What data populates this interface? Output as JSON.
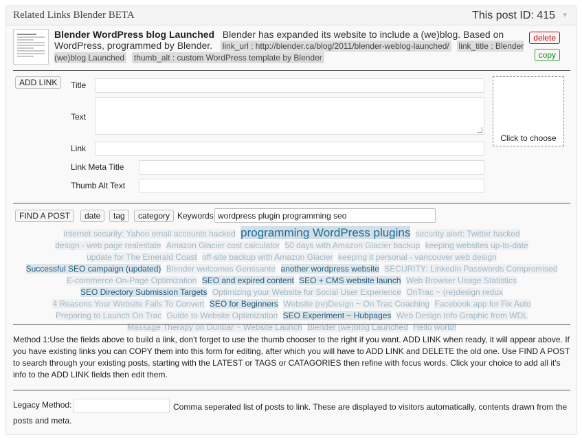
{
  "metabox": {
    "title": "Related Links Blender BETA",
    "post_id": "This post ID: 415",
    "toggle_glyph": "▼"
  },
  "existing_link": {
    "title": "Blender WordPress blog Launched",
    "description": "Blender has expanded its website to include a (we)blog.  Based on WordPress, programmed by Blender.",
    "link_url": "link_url : http://blender.ca/blog/2011/blender-weblog-launched/",
    "link_title": "link_title : Blender (we)blog Launched",
    "thumb_alt": "thumb_alt : custom WordPress template by Blender",
    "delete_label": "delete",
    "copy_label": "copy"
  },
  "form": {
    "add_link_label": "ADD LINK",
    "title_label": "Title",
    "title_value": "",
    "text_label": "Text",
    "text_value": "",
    "link_label": "Link",
    "link_value": "",
    "meta_title_label": "Link Meta Title",
    "meta_title_value": "",
    "thumb_alt_label": "Thumb Alt Text",
    "thumb_alt_value": "",
    "chooser_label": "Click to choose"
  },
  "search": {
    "find_label": "FIND A POST",
    "date_label": "date",
    "tag_label": "tag",
    "category_label": "category",
    "keywords_label": "Keywords",
    "keywords_value": "wordpress plugin programming seo"
  },
  "tags": [
    {
      "text": "internet security: Yahoo email accounts hacked",
      "weight": 1
    },
    {
      "text": "programming WordPress plugins",
      "weight": 4
    },
    {
      "text": "security alert: Twitter hacked",
      "weight": 1
    },
    {
      "text": "design - web page realestate",
      "weight": 1
    },
    {
      "text": "Amazon Glacier cost calculator",
      "weight": 1
    },
    {
      "text": "50 days with Amazon Glacier backup",
      "weight": 1
    },
    {
      "text": "keeping websites up-to-date",
      "weight": 1
    },
    {
      "text": "update for The Emerald Coast",
      "weight": 1
    },
    {
      "text": "off-site backup with Amazon Glacier",
      "weight": 1
    },
    {
      "text": "keeping it personal - vancouver web design",
      "weight": 1
    },
    {
      "text": "Successful SEO campaign (updated)",
      "weight": 3
    },
    {
      "text": "Blender welcomes Genssante",
      "weight": 1
    },
    {
      "text": "another wordpress website",
      "weight": 3
    },
    {
      "text": "SECURITY: LinkedIn Passwords Compromised",
      "weight": 1
    },
    {
      "text": "E-commerce On-Page Optimization",
      "weight": 1
    },
    {
      "text": "SEO and expired content",
      "weight": 3
    },
    {
      "text": "SEO + CMS website launch",
      "weight": 3
    },
    {
      "text": "Web Browser Usage Statistics",
      "weight": 1
    },
    {
      "text": "SEO Directory Submission Targets",
      "weight": 3
    },
    {
      "text": "Optimizing your Website for Social User Experience",
      "weight": 1
    },
    {
      "text": "OnTrac ~ (re)design redux",
      "weight": 1
    },
    {
      "text": "4 Reasons Your Website Fails To Convert",
      "weight": 1
    },
    {
      "text": "SEO for Beginners",
      "weight": 3
    },
    {
      "text": "Website (re)Design ~ On Trac Coaching",
      "weight": 1
    },
    {
      "text": "Facebook app for Fix Auto",
      "weight": 1
    },
    {
      "text": "Preparing to Launch On Trac",
      "weight": 1
    },
    {
      "text": "Guide to Website Optimization",
      "weight": 1
    },
    {
      "text": "SEO Experiment ~ Hubpages",
      "weight": 3
    },
    {
      "text": "Web Design Info Graphic from WDL",
      "weight": 1
    },
    {
      "text": "Massage Therapy on Dunbar ~ Website Launch",
      "weight": 1
    },
    {
      "text": "Blender (we)blog Launched",
      "weight": 1
    },
    {
      "text": "Hello world!",
      "weight": 1
    }
  ],
  "instructions": "Method 1:Use the fields above to build a link, don't forget to use the thumb chooser to the right if you want. ADD LINK when ready, it will appear above. If you have existing links you can COPY them into this form for editing, after which you will have to ADD LINK and DELETE the old one. Use FIND A POST to search through your existing posts, starting with the LATEST or TAGS or CATAGORIES then refine with focus words. Click your choice to add all it's info to the ADD LINK fields then edit them.",
  "legacy": {
    "label": "Legacy Method:",
    "value": "",
    "description": "Comma seperated list of posts to link. These are displayed to visitors automatically, contents drawn from the posts and meta."
  },
  "colors": {
    "delete": "#cc0000",
    "copy": "#1a8a1a",
    "tag_strong": "#225b7c",
    "tag_faint": "#9fb8c6"
  }
}
